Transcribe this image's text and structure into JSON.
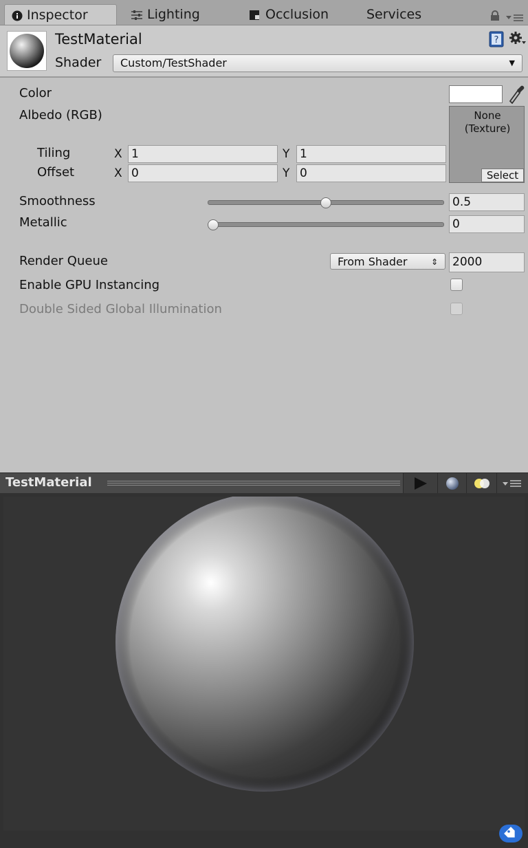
{
  "tabs": [
    {
      "label": "Inspector",
      "icon": "info-icon"
    },
    {
      "label": "Lighting",
      "icon": "sliders-icon"
    },
    {
      "label": "Occlusion",
      "icon": "occlusion-icon"
    },
    {
      "label": "Services",
      "icon": ""
    }
  ],
  "header": {
    "title": "TestMaterial",
    "shader_label": "Shader",
    "shader_value": "Custom/TestShader"
  },
  "properties": {
    "color_label": "Color",
    "color_value": "#ffffff",
    "albedo_label": "Albedo (RGB)",
    "texture_none": "None",
    "texture_type": "(Texture)",
    "texture_select": "Select",
    "tiling_label": "Tiling",
    "offset_label": "Offset",
    "axis_x": "X",
    "axis_y": "Y",
    "tiling_x": "1",
    "tiling_y": "1",
    "offset_x": "0",
    "offset_y": "0",
    "smoothness_label": "Smoothness",
    "smoothness_value": "0.5",
    "smoothness_fraction": 0.5,
    "metallic_label": "Metallic",
    "metallic_value": "0",
    "metallic_fraction": 0,
    "render_queue_label": "Render Queue",
    "render_queue_mode": "From Shader",
    "render_queue_value": "2000",
    "gpu_instancing_label": "Enable GPU Instancing",
    "gpu_instancing_checked": false,
    "double_sided_gi_label": "Double Sided Global Illumination",
    "double_sided_gi_checked": false
  },
  "preview": {
    "title": "TestMaterial"
  },
  "colors": {
    "panel_bg": "#c2c2c2",
    "tab_bar_bg": "#a5a5a5",
    "preview_bg": "#313131",
    "tag_badge": "#2b6fd6"
  }
}
